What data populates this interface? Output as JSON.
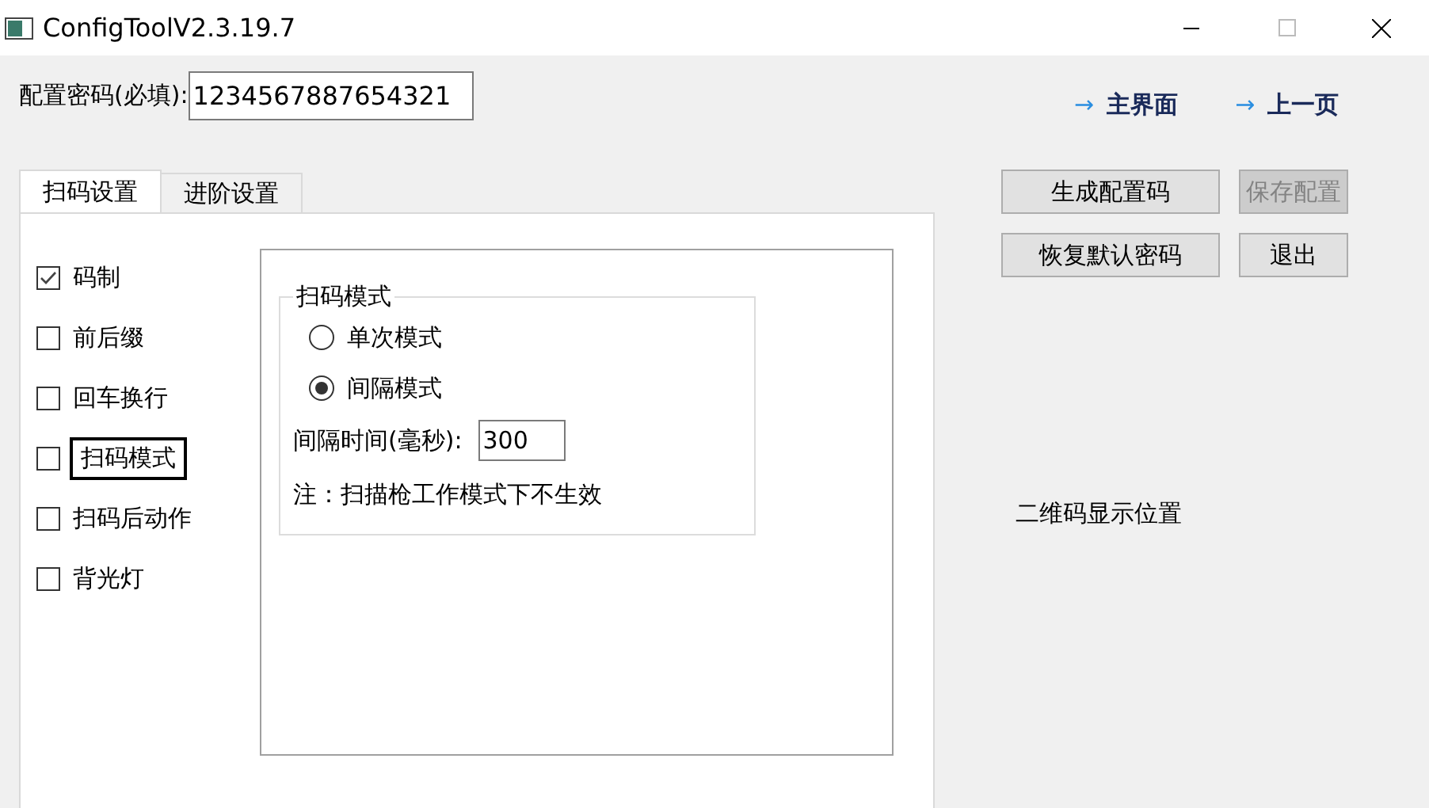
{
  "window": {
    "title": "ConfigToolV2.3.19.7"
  },
  "password": {
    "label": "配置密码(必填):",
    "value": "1234567887654321"
  },
  "nav_links": [
    {
      "arrow": "→",
      "label": "主界面"
    },
    {
      "arrow": "→",
      "label": "上一页"
    }
  ],
  "tabs": [
    {
      "label": "扫码设置",
      "selected": true
    },
    {
      "label": "进阶设置",
      "selected": false
    }
  ],
  "options": [
    {
      "label": "码制",
      "checked": true,
      "focused": false
    },
    {
      "label": "前后缀",
      "checked": false,
      "focused": false
    },
    {
      "label": "回车换行",
      "checked": false,
      "focused": false
    },
    {
      "label": "扫码模式",
      "checked": false,
      "focused": true
    },
    {
      "label": "扫码后动作",
      "checked": false,
      "focused": false
    },
    {
      "label": "背光灯",
      "checked": false,
      "focused": false
    }
  ],
  "scan_mode": {
    "title": "扫码模式",
    "modes": [
      {
        "label": "单次模式",
        "selected": false
      },
      {
        "label": "间隔模式",
        "selected": true
      }
    ],
    "interval": {
      "label": "间隔时间(毫秒):",
      "value": "300"
    },
    "note": "注：扫描枪工作模式下不生效"
  },
  "buttons": [
    {
      "label": "生成配置码",
      "disabled": false
    },
    {
      "label": "保存配置",
      "disabled": true
    },
    {
      "label": "恢复默认密码",
      "disabled": false
    },
    {
      "label": "退出",
      "disabled": false
    }
  ],
  "qr_placeholder": "二维码显示位置"
}
